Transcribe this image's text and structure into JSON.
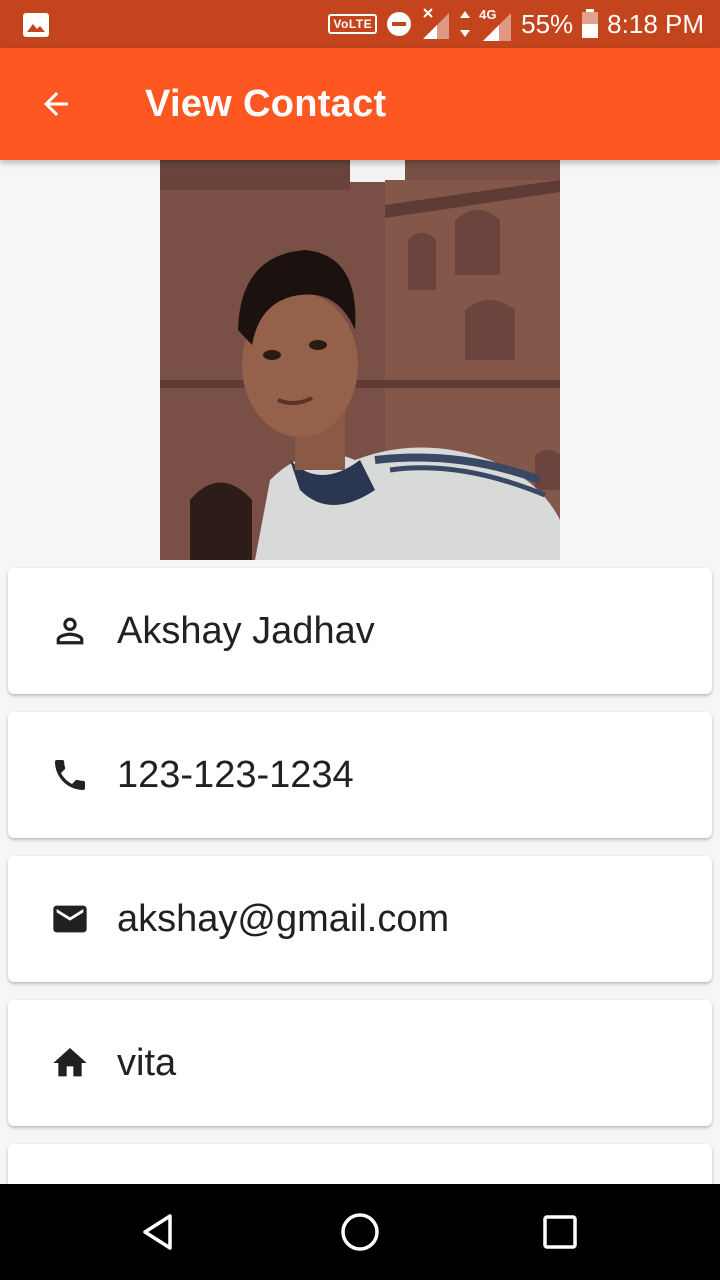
{
  "status_bar": {
    "volte": "VoLTE",
    "network": "4G",
    "battery": "55%",
    "time": "8:18 PM",
    "icons": [
      "image-icon",
      "volte-icon",
      "do-not-disturb-icon",
      "signal-icon",
      "data-arrows-icon",
      "signal-4g-icon",
      "battery-icon"
    ]
  },
  "app_bar": {
    "title": "View Contact",
    "back_icon": "arrow-back-icon",
    "color": "#ff5722"
  },
  "contact": {
    "photo": "contact-photo",
    "name": "Akshay Jadhav",
    "phone": "123-123-1234",
    "email": "akshay@gmail.com",
    "address": "vita",
    "icons": [
      "person-icon",
      "phone-icon",
      "email-icon",
      "home-icon"
    ]
  },
  "nav_bar": {
    "icons": [
      "back-triangle-icon",
      "home-circle-icon",
      "recents-square-icon"
    ]
  },
  "colors": {
    "status_bar": "#c4451d",
    "accent": "#ff5722",
    "background": "#f6f6f6"
  }
}
